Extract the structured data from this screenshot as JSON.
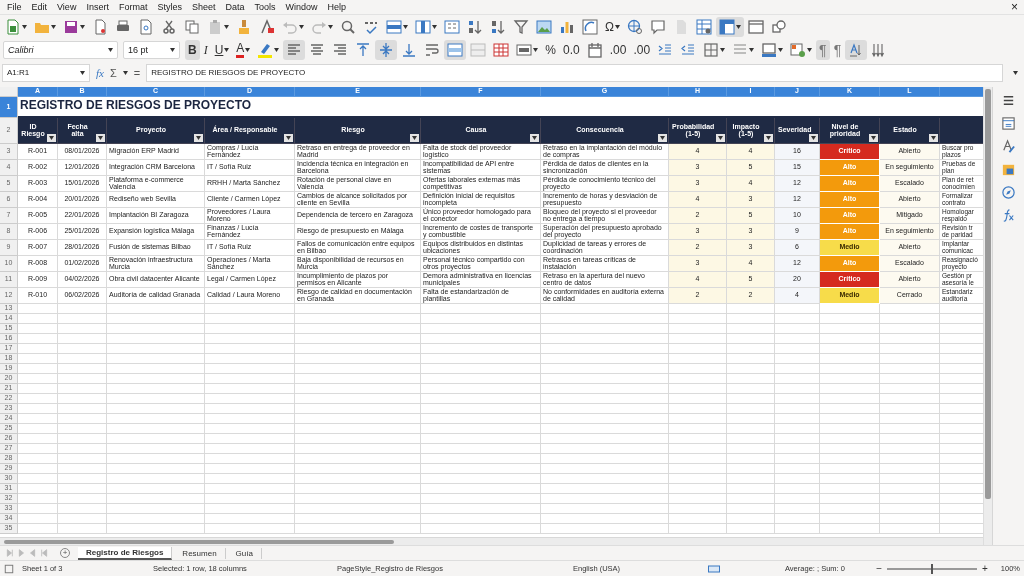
{
  "menu": {
    "items": [
      "File",
      "Edit",
      "View",
      "Insert",
      "Format",
      "Styles",
      "Sheet",
      "Data",
      "Tools",
      "Window",
      "Help"
    ],
    "close": "×"
  },
  "standard_toolbar": [
    {
      "kind": "new",
      "dropdown": true,
      "on": false
    },
    {
      "kind": "open",
      "dropdown": true,
      "on": false
    },
    {
      "kind": "save",
      "dropdown": true,
      "on": false
    },
    {
      "kind": "export-pdf",
      "dropdown": false,
      "on": false
    },
    {
      "kind": "print",
      "dropdown": false,
      "on": false
    },
    {
      "kind": "print-preview",
      "dropdown": false,
      "on": false
    },
    {
      "kind": "cut",
      "dropdown": false,
      "on": false
    },
    {
      "kind": "copy",
      "dropdown": false,
      "on": false
    },
    {
      "kind": "paste",
      "dropdown": true,
      "on": false
    },
    {
      "kind": "clone-formatting",
      "dropdown": false,
      "on": false
    },
    {
      "kind": "clear-formatting",
      "dropdown": false,
      "on": false
    },
    {
      "kind": "undo",
      "dropdown": true,
      "on": false
    },
    {
      "kind": "redo",
      "dropdown": true,
      "on": false
    },
    {
      "kind": "find",
      "dropdown": false,
      "on": false
    },
    {
      "kind": "spelling",
      "dropdown": false,
      "on": false
    },
    {
      "kind": "rows",
      "dropdown": true,
      "on": false
    },
    {
      "kind": "columns",
      "dropdown": true,
      "on": false
    },
    {
      "kind": "sort",
      "dropdown": false,
      "on": false
    },
    {
      "kind": "sort-ascending",
      "dropdown": false,
      "on": false
    },
    {
      "kind": "sort-descending",
      "dropdown": false,
      "on": false
    },
    {
      "kind": "autofilter",
      "dropdown": false,
      "on": false
    },
    {
      "kind": "image",
      "dropdown": false,
      "on": false
    },
    {
      "kind": "chart",
      "dropdown": false,
      "on": false
    },
    {
      "kind": "pivot-table",
      "dropdown": false,
      "on": false
    },
    {
      "kind": "special-character",
      "label": "Ω",
      "dropdown": true,
      "on": false
    },
    {
      "kind": "hyperlink",
      "dropdown": false,
      "on": false
    },
    {
      "kind": "comment",
      "dropdown": false,
      "on": false
    },
    {
      "kind": "page",
      "dropdown": false,
      "on": false
    },
    {
      "kind": "print-area",
      "dropdown": false,
      "on": false
    },
    {
      "kind": "freeze",
      "dropdown": true,
      "on": true
    },
    {
      "kind": "header-footer",
      "dropdown": false,
      "on": false
    },
    {
      "kind": "shapes",
      "dropdown": false,
      "on": false
    }
  ],
  "formatting_toolbar": {
    "font_name": "Calibri",
    "font_size": "16 pt",
    "items": [
      {
        "kind": "bold",
        "label": "B",
        "dropdown": false,
        "on": true
      },
      {
        "kind": "italic",
        "label": "I",
        "dropdown": false,
        "on": false
      },
      {
        "kind": "underline",
        "label": "U",
        "dropdown": true,
        "on": false
      },
      {
        "kind": "font-color",
        "label": "A",
        "dropdown": true,
        "on": false
      },
      {
        "kind": "highlight",
        "dropdown": true,
        "on": false
      },
      {
        "kind": "align-left",
        "dropdown": false,
        "on": true
      },
      {
        "kind": "align-center",
        "dropdown": false,
        "on": false
      },
      {
        "kind": "align-right",
        "dropdown": false,
        "on": false
      },
      {
        "kind": "align-top",
        "dropdown": false,
        "on": false
      },
      {
        "kind": "align-middle",
        "dropdown": false,
        "on": true
      },
      {
        "kind": "align-bottom",
        "dropdown": false,
        "on": false
      },
      {
        "kind": "wrap",
        "dropdown": false,
        "on": false
      },
      {
        "kind": "merge-center",
        "dropdown": false,
        "on": true
      },
      {
        "kind": "merge",
        "dropdown": false,
        "on": false
      },
      {
        "kind": "unmerge",
        "dropdown": false,
        "on": false
      },
      {
        "kind": "number-format",
        "dropdown": true,
        "on": false
      },
      {
        "kind": "percent",
        "label": "%",
        "dropdown": false,
        "on": false
      },
      {
        "kind": "number",
        "label": "0.0",
        "dropdown": false,
        "on": false
      },
      {
        "kind": "date",
        "dropdown": false,
        "on": false
      },
      {
        "kind": "add-decimal",
        "label": ".00",
        "dropdown": false,
        "on": false
      },
      {
        "kind": "delete-decimal",
        "label": ".00",
        "dropdown": false,
        "on": false
      },
      {
        "kind": "indent",
        "dropdown": false,
        "on": false
      },
      {
        "kind": "outdent",
        "dropdown": false,
        "on": false
      },
      {
        "kind": "borders",
        "dropdown": true,
        "on": false
      },
      {
        "kind": "border-style",
        "dropdown": true,
        "on": false
      },
      {
        "kind": "border-color",
        "dropdown": true,
        "on": false
      },
      {
        "kind": "conditional",
        "dropdown": true,
        "on": false
      },
      {
        "kind": "left-to-right",
        "label": "¶",
        "dropdown": false,
        "on": true
      },
      {
        "kind": "right-to-left",
        "label": "¶",
        "dropdown": false,
        "on": false
      },
      {
        "kind": "text-direction",
        "dropdown": false,
        "on": true
      },
      {
        "kind": "vertical-text",
        "dropdown": false,
        "on": false
      }
    ]
  },
  "formula_bar": {
    "cell_reference": "A1:R1",
    "function_wizard": "fx",
    "sum": "Σ",
    "equals": "=",
    "content": "REGISTRO DE RIESGOS DE PROYECTO"
  },
  "sheet": {
    "columns": [
      {
        "letter": "A",
        "heading": "ID Riesgo",
        "filter": true,
        "selected": true
      },
      {
        "letter": "B",
        "heading": "Fecha alta",
        "filter": true,
        "selected": true
      },
      {
        "letter": "C",
        "heading": "Proyecto",
        "filter": true,
        "selected": true
      },
      {
        "letter": "D",
        "heading": "Área / Responsable",
        "filter": true,
        "selected": true
      },
      {
        "letter": "E",
        "heading": "Riesgo",
        "filter": true,
        "selected": true
      },
      {
        "letter": "F",
        "heading": "Causa",
        "filter": true,
        "selected": true
      },
      {
        "letter": "G",
        "heading": "Consecuencia",
        "filter": true,
        "selected": true
      },
      {
        "letter": "H",
        "heading": "Probabilidad (1-5)",
        "filter": true,
        "selected": true
      },
      {
        "letter": "I",
        "heading": "Impacto (1-5)",
        "filter": true,
        "selected": true
      },
      {
        "letter": "J",
        "heading": "Severidad",
        "filter": true,
        "selected": true
      },
      {
        "letter": "K",
        "heading": "Nivel de prioridad",
        "filter": true,
        "selected": true
      },
      {
        "letter": "L",
        "heading": "Estado",
        "filter": true,
        "selected": true
      },
      {
        "filter": false,
        "selected": true
      }
    ],
    "title_row": {
      "number": "1",
      "title": "REGISTRO DE RIESGOS DE PROYECTO",
      "selected": true
    },
    "header_row": {
      "number": "2",
      "selected": false
    },
    "rows": [
      {
        "number": "3",
        "selected": false,
        "color": "#d52a1f",
        "cells": [
          "R-001",
          "08/01/2026",
          "Migración ERP Madrid",
          "Compras / Lucía Fernández",
          "Retraso en entrega de proveedor en Madrid",
          "Falta de stock del proveedor logístico",
          "Retraso en la implantación del módulo de compras",
          "4",
          "4",
          "16",
          "Crítico",
          "Abierto",
          "Buscar pro\nplazos"
        ]
      },
      {
        "number": "4",
        "selected": false,
        "color": "#f39a0c",
        "cells": [
          "R-002",
          "12/01/2026",
          "Integración CRM Barcelona",
          "IT / Sofía Ruiz",
          "Incidencia técnica en integración en Barcelona",
          "Incompatibilidad de API entre sistemas",
          "Pérdida de datos de clientes en la sincronización",
          "3",
          "5",
          "15",
          "Alto",
          "En seguimiento",
          "Pruebas de\nplan"
        ]
      },
      {
        "number": "5",
        "selected": false,
        "color": "#f39a0c",
        "cells": [
          "R-003",
          "15/01/2026",
          "Plataforma e-commerce Valencia",
          "RRHH / Marta Sánchez",
          "Rotación de personal clave en Valencia",
          "Ofertas laborales externas más competitivas",
          "Pérdida de conocimiento técnico del proyecto",
          "3",
          "4",
          "12",
          "Alto",
          "Escalado",
          "Plan de ret\nconocimien"
        ]
      },
      {
        "number": "6",
        "selected": false,
        "color": "#f39a0c",
        "cells": [
          "R-004",
          "20/01/2026",
          "Rediseño web Sevilla",
          "Cliente / Carmen López",
          "Cambios de alcance solicitados por cliente en Sevilla",
          "Definición inicial de requisitos incompleta",
          "Incremento de horas y desviación de presupuesto",
          "4",
          "3",
          "12",
          "Alto",
          "Abierto",
          "Formalizar\ncontrato"
        ]
      },
      {
        "number": "7",
        "selected": false,
        "color": "#f39a0c",
        "cells": [
          "R-005",
          "22/01/2026",
          "Implantación BI Zaragoza",
          "Proveedores / Laura Moreno",
          "Dependencia de tercero en Zaragoza",
          "Único proveedor homologado para el conector",
          "Bloqueo del proyecto si el proveedor no entrega a tiempo",
          "2",
          "5",
          "10",
          "Alto",
          "Mitigado",
          "Homologar\nrespaldo"
        ]
      },
      {
        "number": "8",
        "selected": false,
        "color": "#f39a0c",
        "cells": [
          "R-006",
          "25/01/2026",
          "Expansión logística Málaga",
          "Finanzas / Lucía Fernández",
          "Riesgo de presupuesto en Málaga",
          "Incremento de costes de transporte y combustible",
          "Superación del presupuesto aprobado del proyecto",
          "3",
          "3",
          "9",
          "Alto",
          "En seguimiento",
          "Revisión tr\nde paridad"
        ]
      },
      {
        "number": "9",
        "selected": false,
        "color": "#f7dc4a",
        "cells": [
          "R-007",
          "28/01/2026",
          "Fusión de sistemas Bilbao",
          "IT / Sofía Ruiz",
          "Fallos de comunicación entre equipos en Bilbao",
          "Equipos distribuidos en distintas ubicaciones",
          "Duplicidad de tareas y errores de coordinación",
          "2",
          "3",
          "6",
          "Medio",
          "Abierto",
          "Implantar\ncomunicac"
        ]
      },
      {
        "number": "10",
        "selected": false,
        "color": "#f39a0c",
        "cells": [
          "R-008",
          "01/02/2026",
          "Renovación infraestructura Murcia",
          "Operaciones / Marta Sánchez",
          "Baja disponibilidad de recursos en Murcia",
          "Personal técnico compartido con otros proyectos",
          "Retrasos en tareas críticas de instalación",
          "3",
          "4",
          "12",
          "Alto",
          "Escalado",
          "Reasignació\nproyecto"
        ]
      },
      {
        "number": "11",
        "selected": false,
        "color": "#d52a1f",
        "cells": [
          "R-009",
          "04/02/2026",
          "Obra civil datacenter Alicante",
          "Legal / Carmen López",
          "Incumplimiento de plazos por permisos en Alicante",
          "Demora administrativa en licencias municipales",
          "Retraso en la apertura del nuevo centro de datos",
          "4",
          "5",
          "20",
          "Crítico",
          "Abierto",
          "Gestión pr\nasesoría le"
        ]
      },
      {
        "number": "12",
        "selected": false,
        "color": "#f7dc4a",
        "cells": [
          "R-010",
          "06/02/2026",
          "Auditoría de calidad Granada",
          "Calidad / Laura Moreno",
          "Riesgo de calidad en documentación en Granada",
          "Falta de estandarización de plantillas",
          "No conformidades en auditoría externa de calidad",
          "2",
          "2",
          "4",
          "Medio",
          "Cerrado",
          "Estandariz\nauditoría"
        ]
      }
    ],
    "empty_rows": [
      "13",
      "14",
      "15",
      "16",
      "17",
      "18",
      "19",
      "20",
      "21",
      "22",
      "23",
      "24",
      "25",
      "26",
      "27",
      "28",
      "29",
      "30",
      "31",
      "32",
      "33",
      "34",
      "35"
    ]
  },
  "sidebar": [
    {
      "kind": "menu"
    },
    {
      "kind": "properties"
    },
    {
      "kind": "styles"
    },
    {
      "kind": "gallery"
    },
    {
      "kind": "navigator"
    },
    {
      "kind": "functions"
    }
  ],
  "sheet_tabs": {
    "add": "+",
    "tabs": [
      {
        "label": "Registro de Riesgos",
        "selected": true
      },
      {
        "label": "Resumen",
        "selected": false
      },
      {
        "label": "Guía",
        "selected": false
      }
    ]
  },
  "status_bar": {
    "sheet": "Sheet 1 of 3",
    "selection": "Selected: 1 row, 18 columns",
    "page_style": "PageStyle_Registro de Riesgos",
    "language": "English (USA)",
    "summary": "Average: ; Sum: 0",
    "zoom_out": "−",
    "zoom_in": "+",
    "level": 0.5,
    "zoom": "100%"
  }
}
